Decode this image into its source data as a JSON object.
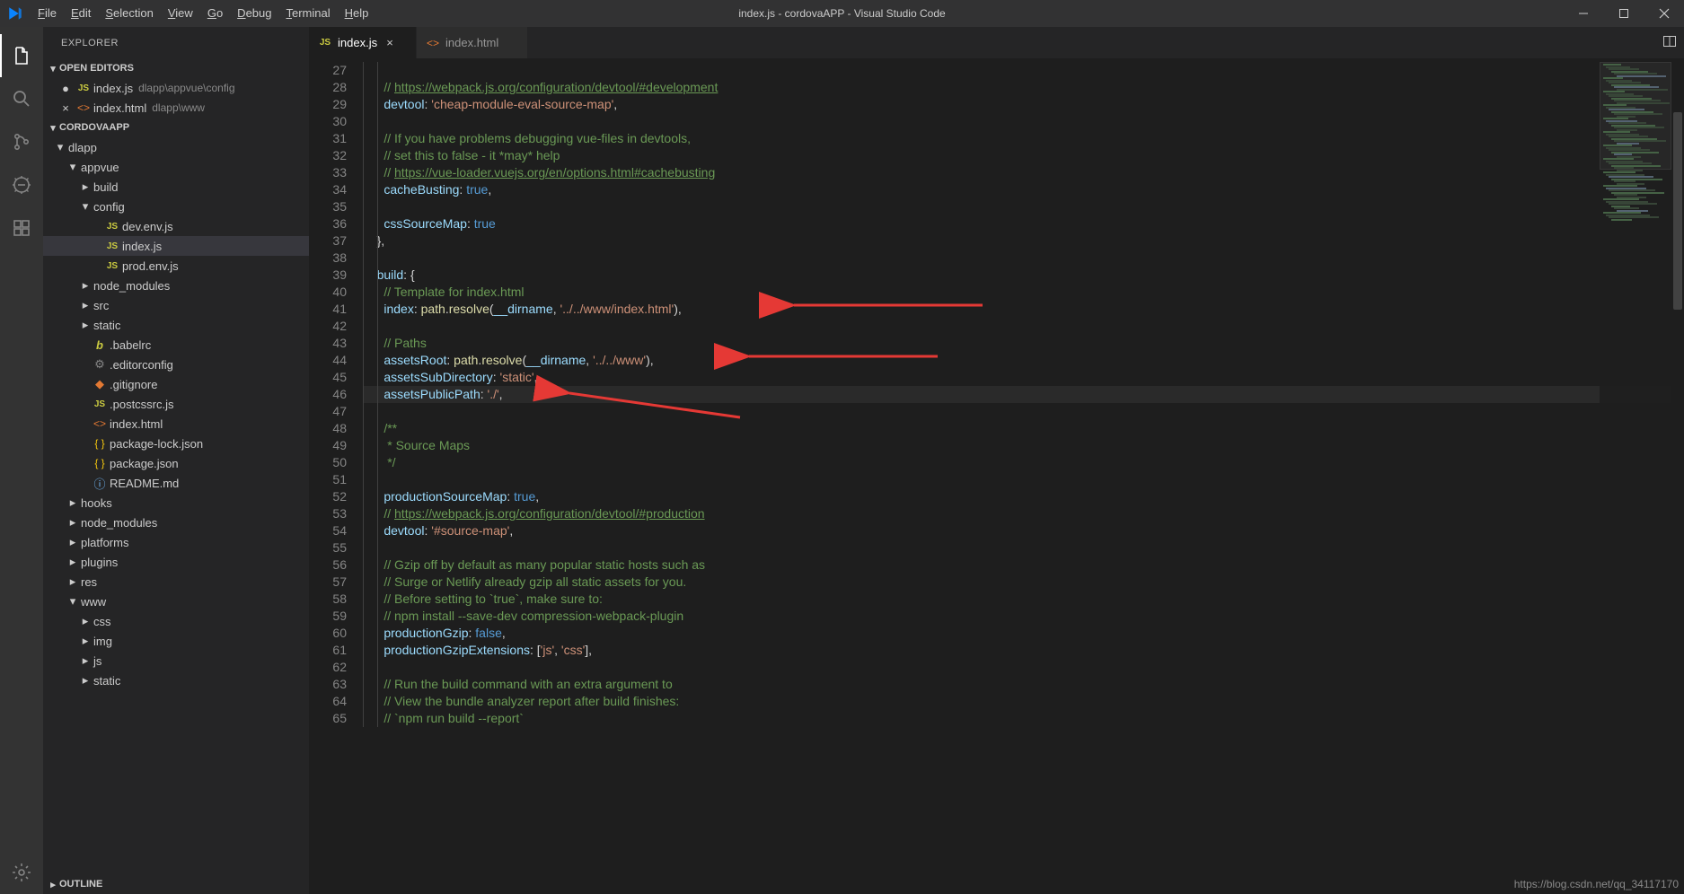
{
  "title": "index.js - cordovaAPP - Visual Studio Code",
  "menubar": [
    "File",
    "Edit",
    "Selection",
    "View",
    "Go",
    "Debug",
    "Terminal",
    "Help"
  ],
  "sidebar": {
    "title": "EXPLORER",
    "sections": {
      "openEditors": {
        "label": "OPEN EDITORS",
        "items": [
          {
            "name": "index.js",
            "desc": "dlapp\\appvue\\config",
            "type": "js",
            "dirty": true
          },
          {
            "name": "index.html",
            "desc": "dlapp\\www",
            "type": "html",
            "dirty": false
          }
        ]
      },
      "project": {
        "label": "CORDOVAAPP"
      },
      "outline": {
        "label": "OUTLINE"
      }
    },
    "tree": [
      {
        "depth": 0,
        "kind": "folder",
        "open": true,
        "name": "dlapp"
      },
      {
        "depth": 1,
        "kind": "folder",
        "open": true,
        "name": "appvue"
      },
      {
        "depth": 2,
        "kind": "folder",
        "open": false,
        "name": "build"
      },
      {
        "depth": 2,
        "kind": "folder",
        "open": true,
        "name": "config"
      },
      {
        "depth": 3,
        "kind": "file",
        "ft": "js",
        "name": "dev.env.js"
      },
      {
        "depth": 3,
        "kind": "file",
        "ft": "js",
        "name": "index.js",
        "selected": true
      },
      {
        "depth": 3,
        "kind": "file",
        "ft": "js",
        "name": "prod.env.js"
      },
      {
        "depth": 2,
        "kind": "folder",
        "open": false,
        "name": "node_modules"
      },
      {
        "depth": 2,
        "kind": "folder",
        "open": false,
        "name": "src"
      },
      {
        "depth": 2,
        "kind": "folder",
        "open": false,
        "name": "static"
      },
      {
        "depth": 2,
        "kind": "file",
        "ft": "babel",
        "name": ".babelrc"
      },
      {
        "depth": 2,
        "kind": "file",
        "ft": "gear",
        "name": ".editorconfig"
      },
      {
        "depth": 2,
        "kind": "file",
        "ft": "git",
        "name": ".gitignore"
      },
      {
        "depth": 2,
        "kind": "file",
        "ft": "js",
        "name": ".postcssrc.js"
      },
      {
        "depth": 2,
        "kind": "file",
        "ft": "html",
        "name": "index.html"
      },
      {
        "depth": 2,
        "kind": "file",
        "ft": "json",
        "name": "package-lock.json"
      },
      {
        "depth": 2,
        "kind": "file",
        "ft": "json",
        "name": "package.json"
      },
      {
        "depth": 2,
        "kind": "file",
        "ft": "info",
        "name": "README.md"
      },
      {
        "depth": 1,
        "kind": "folder",
        "open": false,
        "name": "hooks"
      },
      {
        "depth": 1,
        "kind": "folder",
        "open": false,
        "name": "node_modules"
      },
      {
        "depth": 1,
        "kind": "folder",
        "open": false,
        "name": "platforms"
      },
      {
        "depth": 1,
        "kind": "folder",
        "open": false,
        "name": "plugins"
      },
      {
        "depth": 1,
        "kind": "folder",
        "open": false,
        "name": "res"
      },
      {
        "depth": 1,
        "kind": "folder",
        "open": true,
        "name": "www"
      },
      {
        "depth": 2,
        "kind": "folder",
        "open": false,
        "name": "css"
      },
      {
        "depth": 2,
        "kind": "folder",
        "open": false,
        "name": "img"
      },
      {
        "depth": 2,
        "kind": "folder",
        "open": false,
        "name": "js"
      },
      {
        "depth": 2,
        "kind": "folder",
        "open": false,
        "name": "static"
      }
    ]
  },
  "tabs": [
    {
      "label": "index.js",
      "type": "js",
      "active": true,
      "closeGlyph": "×"
    },
    {
      "label": "index.html",
      "type": "html",
      "active": false,
      "closeGlyph": ""
    }
  ],
  "watermark": "https://blog.csdn.net/qq_34117170",
  "code": {
    "startLine": 27,
    "lines": [
      [
        [
          "pn",
          "    "
        ]
      ],
      [
        [
          "pn",
          "    "
        ],
        [
          "com",
          "// "
        ],
        [
          "link",
          "https://webpack.js.org/configuration/devtool/#development"
        ]
      ],
      [
        [
          "pn",
          "    "
        ],
        [
          "key",
          "devtool"
        ],
        [
          "pn",
          ": "
        ],
        [
          "str",
          "'cheap-module-eval-source-map'"
        ],
        [
          "pn",
          ","
        ]
      ],
      [
        [
          "pn",
          ""
        ]
      ],
      [
        [
          "pn",
          "    "
        ],
        [
          "com",
          "// If you have problems debugging vue-files in devtools,"
        ]
      ],
      [
        [
          "pn",
          "    "
        ],
        [
          "com",
          "// set this to false - it *may* help"
        ]
      ],
      [
        [
          "pn",
          "    "
        ],
        [
          "com",
          "// "
        ],
        [
          "link",
          "https://vue-loader.vuejs.org/en/options.html#cachebusting"
        ]
      ],
      [
        [
          "pn",
          "    "
        ],
        [
          "key",
          "cacheBusting"
        ],
        [
          "pn",
          ": "
        ],
        [
          "bool",
          "true"
        ],
        [
          "pn",
          ","
        ]
      ],
      [
        [
          "pn",
          ""
        ]
      ],
      [
        [
          "pn",
          "    "
        ],
        [
          "key",
          "cssSourceMap"
        ],
        [
          "pn",
          ": "
        ],
        [
          "bool",
          "true"
        ]
      ],
      [
        [
          "pn",
          "  "
        ],
        [
          "pn",
          "},"
        ]
      ],
      [
        [
          "pn",
          ""
        ]
      ],
      [
        [
          "pn",
          "  "
        ],
        [
          "key",
          "build"
        ],
        [
          "pn",
          ": "
        ],
        [
          "pn",
          "{"
        ]
      ],
      [
        [
          "pn",
          "    "
        ],
        [
          "com",
          "// Template for index.html"
        ]
      ],
      [
        [
          "pn",
          "    "
        ],
        [
          "key",
          "index"
        ],
        [
          "pn",
          ": "
        ],
        [
          "id",
          "path"
        ],
        [
          "pn",
          "."
        ],
        [
          "id",
          "resolve"
        ],
        [
          "pn",
          "("
        ],
        [
          "key",
          "__dirname"
        ],
        [
          "pn",
          ", "
        ],
        [
          "str",
          "'../../www/index.html'"
        ],
        [
          "pn",
          "),"
        ]
      ],
      [
        [
          "pn",
          ""
        ]
      ],
      [
        [
          "pn",
          "    "
        ],
        [
          "com",
          "// Paths"
        ]
      ],
      [
        [
          "pn",
          "    "
        ],
        [
          "key",
          "assetsRoot"
        ],
        [
          "pn",
          ": "
        ],
        [
          "id",
          "path"
        ],
        [
          "pn",
          "."
        ],
        [
          "id",
          "resolve"
        ],
        [
          "pn",
          "("
        ],
        [
          "key",
          "__dirname"
        ],
        [
          "pn",
          ", "
        ],
        [
          "str",
          "'../../www'"
        ],
        [
          "pn",
          "),"
        ]
      ],
      [
        [
          "pn",
          "    "
        ],
        [
          "key",
          "assetsSubDirectory"
        ],
        [
          "pn",
          ": "
        ],
        [
          "str",
          "'static'"
        ],
        [
          "pn",
          ","
        ]
      ],
      [
        [
          "pn",
          "    "
        ],
        [
          "key",
          "assetsPublicPath"
        ],
        [
          "pn",
          ": "
        ],
        [
          "str",
          "'./'"
        ],
        [
          "pn",
          ","
        ]
      ],
      [
        [
          "pn",
          ""
        ]
      ],
      [
        [
          "pn",
          "    "
        ],
        [
          "com",
          "/**"
        ]
      ],
      [
        [
          "pn",
          "    "
        ],
        [
          "com",
          " * Source Maps"
        ]
      ],
      [
        [
          "pn",
          "    "
        ],
        [
          "com",
          " */"
        ]
      ],
      [
        [
          "pn",
          ""
        ]
      ],
      [
        [
          "pn",
          "    "
        ],
        [
          "key",
          "productionSourceMap"
        ],
        [
          "pn",
          ": "
        ],
        [
          "bool",
          "true"
        ],
        [
          "pn",
          ","
        ]
      ],
      [
        [
          "pn",
          "    "
        ],
        [
          "com",
          "// "
        ],
        [
          "link",
          "https://webpack.js.org/configuration/devtool/#production"
        ]
      ],
      [
        [
          "pn",
          "    "
        ],
        [
          "key",
          "devtool"
        ],
        [
          "pn",
          ": "
        ],
        [
          "str",
          "'#source-map'"
        ],
        [
          "pn",
          ","
        ]
      ],
      [
        [
          "pn",
          ""
        ]
      ],
      [
        [
          "pn",
          "    "
        ],
        [
          "com",
          "// Gzip off by default as many popular static hosts such as"
        ]
      ],
      [
        [
          "pn",
          "    "
        ],
        [
          "com",
          "// Surge or Netlify already gzip all static assets for you."
        ]
      ],
      [
        [
          "pn",
          "    "
        ],
        [
          "com",
          "// Before setting to `true`, make sure to:"
        ]
      ],
      [
        [
          "pn",
          "    "
        ],
        [
          "com",
          "// npm install --save-dev compression-webpack-plugin"
        ]
      ],
      [
        [
          "pn",
          "    "
        ],
        [
          "key",
          "productionGzip"
        ],
        [
          "pn",
          ": "
        ],
        [
          "bool",
          "false"
        ],
        [
          "pn",
          ","
        ]
      ],
      [
        [
          "pn",
          "    "
        ],
        [
          "key",
          "productionGzipExtensions"
        ],
        [
          "pn",
          ": ["
        ],
        [
          "str",
          "'js'"
        ],
        [
          "pn",
          ", "
        ],
        [
          "str",
          "'css'"
        ],
        [
          "pn",
          "],"
        ]
      ],
      [
        [
          "pn",
          ""
        ]
      ],
      [
        [
          "pn",
          "    "
        ],
        [
          "com",
          "// Run the build command with an extra argument to"
        ]
      ],
      [
        [
          "pn",
          "    "
        ],
        [
          "com",
          "// View the bundle analyzer report after build finishes:"
        ]
      ],
      [
        [
          "pn",
          "    "
        ],
        [
          "com",
          "// `npm run build --report`"
        ]
      ]
    ],
    "currentLineIndex": 19
  }
}
